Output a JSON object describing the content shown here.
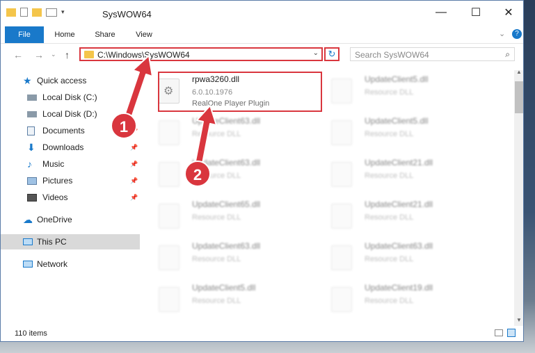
{
  "window": {
    "title": "SysWOW64"
  },
  "ribbon": {
    "tabs": [
      "File",
      "Home",
      "Share",
      "View"
    ]
  },
  "address": {
    "path": "C:\\Windows\\SysWOW64",
    "search_placeholder": "Search SysWOW64"
  },
  "sidebar": {
    "items": [
      {
        "label": "Quick access",
        "icon": "star-icon",
        "pinned": false
      },
      {
        "label": "Local Disk (C:)",
        "icon": "drive-icon",
        "pinned": false
      },
      {
        "label": "Local Disk (D:)",
        "icon": "drive-icon",
        "pinned": false
      },
      {
        "label": "Documents",
        "icon": "document-icon",
        "pinned": true
      },
      {
        "label": "Downloads",
        "icon": "download-icon",
        "pinned": true
      },
      {
        "label": "Music",
        "icon": "music-icon",
        "pinned": true
      },
      {
        "label": "Pictures",
        "icon": "picture-icon",
        "pinned": true
      },
      {
        "label": "Videos",
        "icon": "video-icon",
        "pinned": true
      },
      {
        "label": "OneDrive",
        "icon": "cloud-icon",
        "pinned": false
      },
      {
        "label": "This PC",
        "icon": "computer-icon",
        "pinned": false,
        "selected": true
      },
      {
        "label": "Network",
        "icon": "network-icon",
        "pinned": false
      }
    ]
  },
  "files": {
    "selected": {
      "name": "rpwa3260.dll",
      "version": "6.0.10.1976",
      "description": "RealOne Player Plugin"
    },
    "left_column": [
      {
        "name": "UpdateClient63.dll",
        "type": "Resource DLL"
      },
      {
        "name": "UpdateClient63.dll",
        "type": "Resource DLL"
      },
      {
        "name": "UpdateClient65.dll",
        "type": "Resource DLL"
      },
      {
        "name": "UpdateClient63.dll",
        "type": "Resource DLL"
      },
      {
        "name": "UpdateClient5.dll",
        "type": "Resource DLL"
      }
    ],
    "right_column": [
      {
        "name": "UpdateClient5.dll",
        "type": "Resource DLL"
      },
      {
        "name": "UpdateClient5.dll",
        "type": "Resource DLL"
      },
      {
        "name": "UpdateClient21.dll",
        "type": "Resource DLL"
      },
      {
        "name": "UpdateClient21.dll",
        "type": "Resource DLL"
      },
      {
        "name": "UpdateClient63.dll",
        "type": "Resource DLL"
      },
      {
        "name": "UpdateClient19.dll",
        "type": "Resource DLL"
      }
    ]
  },
  "status": {
    "items": "110 items"
  },
  "annotations": {
    "step1": "1",
    "step2": "2"
  },
  "colors": {
    "accent": "#1979ca",
    "highlight": "#d9363e"
  }
}
